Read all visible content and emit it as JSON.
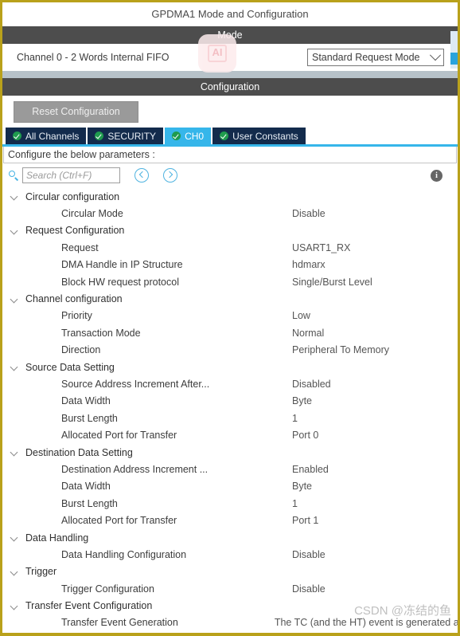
{
  "panel": {
    "title": "GPDMA1 Mode and Configuration",
    "mode_bar": "Mode",
    "configuration_bar": "Configuration"
  },
  "mode": {
    "channel_label": "Channel 0  - 2 Words Internal FIFO",
    "request_mode_value": "Standard Request Mode",
    "chevron_icon": "chevron-down-icon"
  },
  "toolbar": {
    "reset_label": "Reset Configuration"
  },
  "tabs": [
    {
      "label": "All Channels",
      "active": false,
      "icon": "check-circle-icon"
    },
    {
      "label": "SECURITY",
      "active": false,
      "icon": "check-circle-icon"
    },
    {
      "label": "CH0",
      "active": true,
      "icon": "check-circle-icon"
    },
    {
      "label": "User Constants",
      "active": false,
      "icon": "check-circle-icon"
    }
  ],
  "hint": "Configure the below parameters :",
  "search": {
    "placeholder": "Search (Ctrl+F)",
    "value": "",
    "icon": "search-icon",
    "prev_icon": "chevron-left-circle-icon",
    "next_icon": "chevron-right-circle-icon",
    "info_icon": "info-icon",
    "info_glyph": "i"
  },
  "tree": [
    {
      "kind": "group",
      "name": "Circular configuration",
      "value": ""
    },
    {
      "kind": "leaf",
      "name": "Circular Mode",
      "value": "Disable"
    },
    {
      "kind": "group",
      "name": "Request Configuration",
      "value": ""
    },
    {
      "kind": "leaf",
      "name": "Request",
      "value": "USART1_RX"
    },
    {
      "kind": "leaf",
      "name": "DMA Handle in IP Structure",
      "value": "hdmarx"
    },
    {
      "kind": "leaf",
      "name": "Block HW request protocol",
      "value": "Single/Burst Level"
    },
    {
      "kind": "group",
      "name": "Channel configuration",
      "value": ""
    },
    {
      "kind": "leaf",
      "name": "Priority",
      "value": "Low"
    },
    {
      "kind": "leaf",
      "name": "Transaction Mode",
      "value": "Normal"
    },
    {
      "kind": "leaf",
      "name": "Direction",
      "value": "Peripheral To Memory"
    },
    {
      "kind": "group",
      "name": "Source Data Setting",
      "value": ""
    },
    {
      "kind": "leaf",
      "name": "Source Address Increment After...",
      "value": "Disabled"
    },
    {
      "kind": "leaf",
      "name": "Data Width",
      "value": "Byte"
    },
    {
      "kind": "leaf",
      "name": "Burst Length",
      "value": "1"
    },
    {
      "kind": "leaf",
      "name": "Allocated Port for Transfer",
      "value": "Port 0"
    },
    {
      "kind": "group",
      "name": "Destination Data Setting",
      "value": ""
    },
    {
      "kind": "leaf",
      "name": "Destination Address Increment ...",
      "value": "Enabled"
    },
    {
      "kind": "leaf",
      "name": "Data Width",
      "value": "Byte"
    },
    {
      "kind": "leaf",
      "name": "Burst Length",
      "value": "1"
    },
    {
      "kind": "leaf",
      "name": "Allocated Port for Transfer",
      "value": "Port 1"
    },
    {
      "kind": "group",
      "name": "Data Handling",
      "value": ""
    },
    {
      "kind": "leaf",
      "name": "Data Handling Configuration",
      "value": "Disable"
    },
    {
      "kind": "group",
      "name": "Trigger",
      "value": ""
    },
    {
      "kind": "leaf",
      "name": "Trigger Configuration",
      "value": "Disable"
    },
    {
      "kind": "group",
      "name": "Transfer Event Configuration",
      "value": ""
    },
    {
      "kind": "leaf",
      "name": "Transfer Event Generation",
      "value": "The TC (and the HT) event is generated at ..."
    }
  ],
  "watermarks": {
    "ai_logo": "AI",
    "csdn": "CSDN @冻结的鱼"
  },
  "colors": {
    "frame": "#b9a11b",
    "section_bar": "#4d4d4d",
    "tab_inactive": "#132b4c",
    "tab_active": "#36b6ea",
    "check_green": "#1f9b4e",
    "accent_blue": "#45b3e3"
  }
}
